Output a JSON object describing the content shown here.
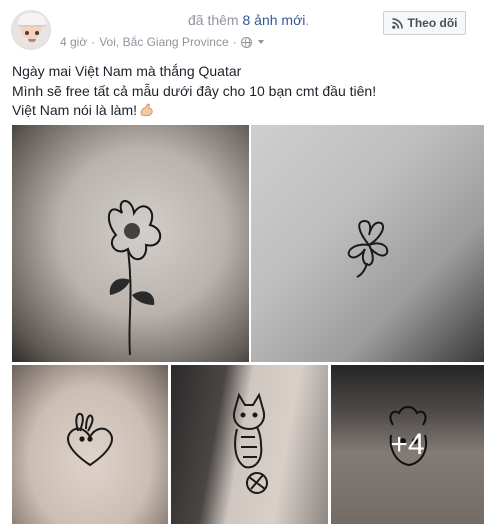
{
  "post": {
    "headline_prefix": "đã thêm",
    "headline_count": "8 ảnh mới",
    "headline_suffix": ".",
    "time": "4 giờ",
    "location": "Voi, Bắc Giang Province",
    "follow_label": "Theo dõi",
    "text_lines": [
      "Ngày mai Việt Nam mà thắng Quatar",
      "Mình sẽ free tất cả mẫu dưới đây cho 10 bạn cmt đầu tiên!",
      "Việt Nam nói là làm!"
    ],
    "more_photos_label": "+4"
  },
  "icons": {
    "follow": "rss-icon",
    "privacy": "globe-icon",
    "emoji": "flexed-biceps-icon"
  },
  "colors": {
    "link": "#365899",
    "meta": "#90949c",
    "text": "#1d2129"
  }
}
